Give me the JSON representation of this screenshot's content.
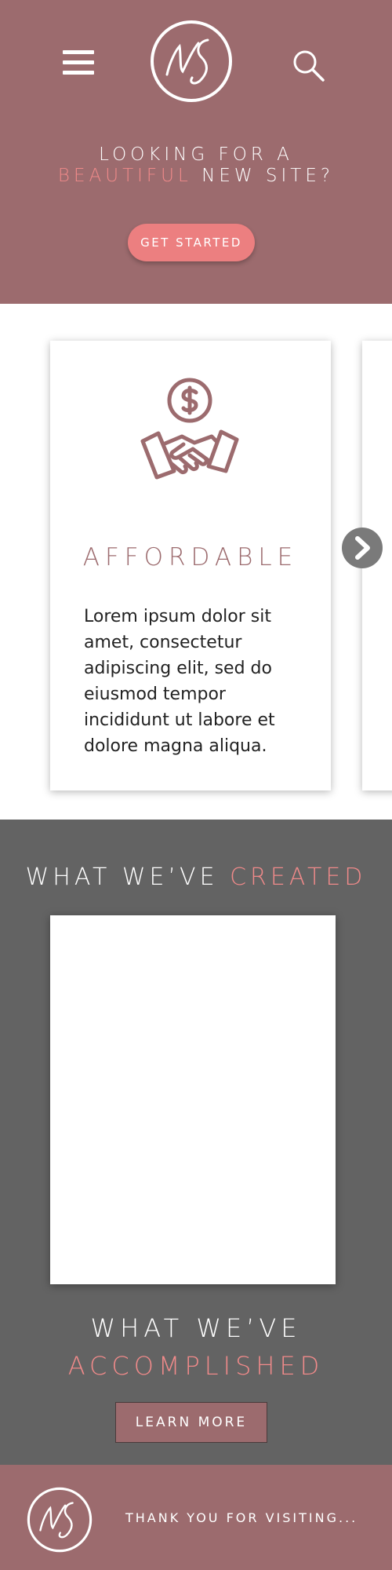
{
  "header": {
    "logo_text": "NS",
    "menu_icon": "hamburger-menu-icon",
    "search_icon": "search-icon"
  },
  "hero": {
    "tagline_line1": "LOOKING FOR A",
    "tagline_accent": "BEAUTIFUL",
    "tagline_rest": " NEW SITE?",
    "cta_label": "GET STARTED"
  },
  "features": {
    "cards": [
      {
        "icon": "handshake-dollar-icon",
        "title": "AFFORDABLE",
        "body": "Lorem ipsum dolor sit amet, consectetur adipiscing elit, sed do eiusmod tempor incididunt ut labore et dolore magna aliqua."
      }
    ],
    "next_icon": "chevron-right-icon"
  },
  "portfolio": {
    "created_title": "WHAT WE’VE ",
    "created_accent": "CREATED",
    "accomplished_title": "WHAT WE’VE",
    "accomplished_accent": "ACCOMPLISHED",
    "learn_more_label": "LEARN MORE"
  },
  "footer": {
    "text": "THANK YOU FOR VISITING..."
  },
  "colors": {
    "brand_mauve": "#9c6b6e",
    "accent_pink": "#f08a8a",
    "button_pink": "#ec7f80",
    "portfolio_gray": "#636363"
  }
}
